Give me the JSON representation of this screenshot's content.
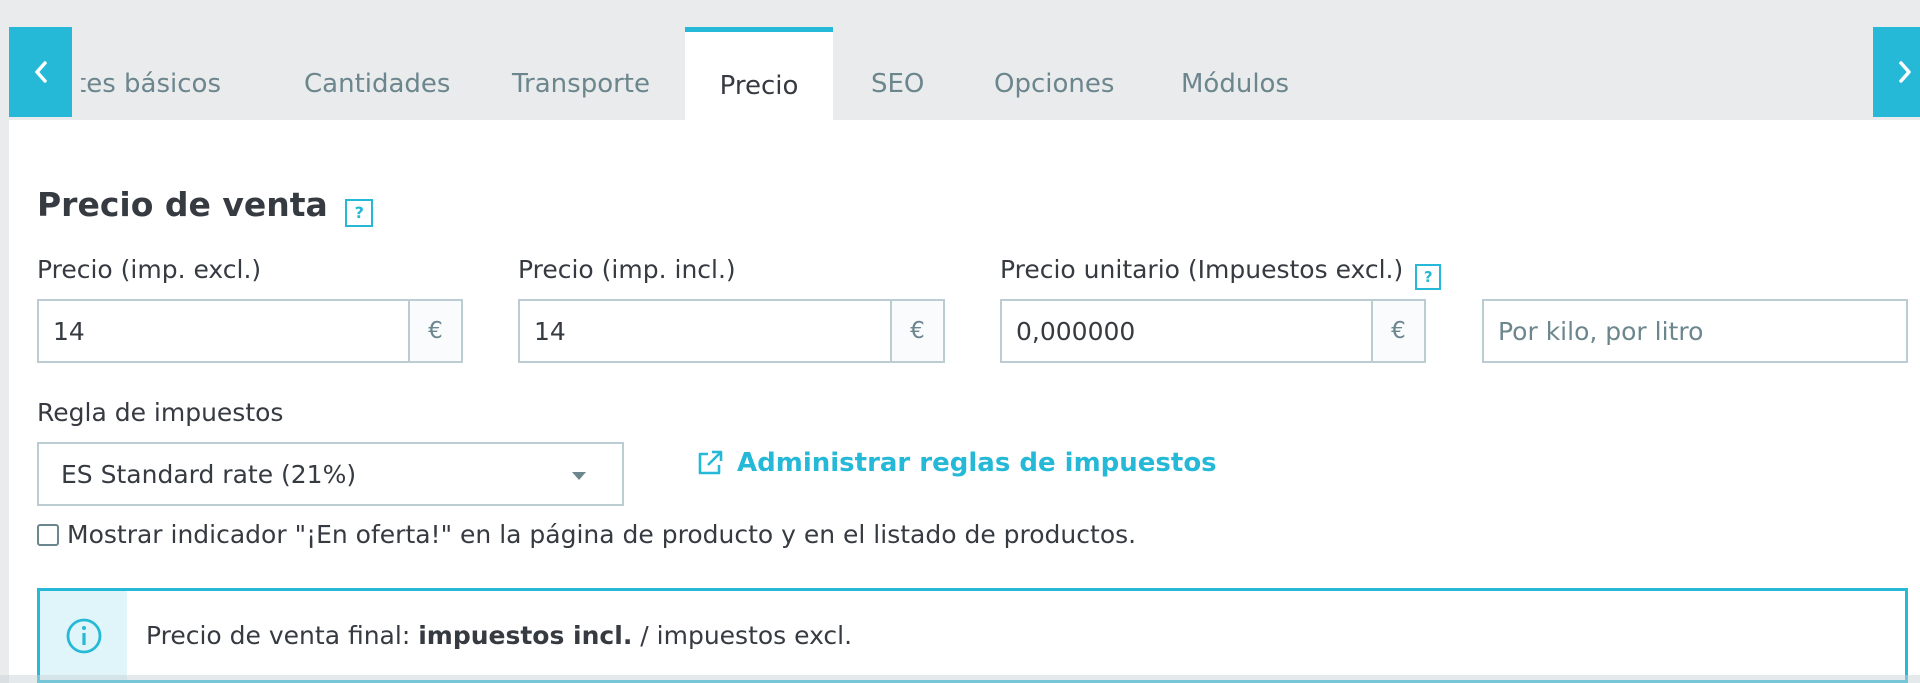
{
  "tabs": [
    {
      "label": "Ajustes básicos",
      "active": false
    },
    {
      "label": "Cantidades",
      "active": false
    },
    {
      "label": "Transporte",
      "active": false
    },
    {
      "label": "Precio",
      "active": true
    },
    {
      "label": "SEO",
      "active": false
    },
    {
      "label": "Opciones",
      "active": false
    },
    {
      "label": "Módulos",
      "active": false
    }
  ],
  "icons": {
    "prev": "chevron-left-icon",
    "next": "chevron-right-icon",
    "help": "help-icon",
    "external_link": "external-link-icon",
    "info": "info-icon",
    "caret": "caret-down-icon"
  },
  "section": {
    "title": "Precio de venta",
    "help_glyph": "?"
  },
  "fields": {
    "price_excl": {
      "label": "Precio (imp. excl.)",
      "value": "14",
      "currency": "€"
    },
    "price_incl": {
      "label": "Precio (imp. incl.)",
      "value": "14",
      "currency": "€"
    },
    "unit_price": {
      "label": "Precio unitario (Impuestos excl.)",
      "value": "0,000000",
      "currency": "€",
      "help_glyph": "?"
    },
    "unity": {
      "placeholder": "Por kilo, por litro",
      "value": ""
    }
  },
  "tax_rule": {
    "label": "Regla de impuestos",
    "selected": "ES Standard rate (21%)",
    "manage_link": "Administrar reglas de impuestos"
  },
  "on_sale": {
    "label": "Mostrar indicador \"¡En oferta!\" en la página de producto y en el listado de productos.",
    "checked": false
  },
  "alert": {
    "prefix": "Precio de venta final: ",
    "bold": "impuestos incl.",
    "suffix": " / impuestos excl."
  },
  "colors": {
    "accent": "#25b9d7",
    "text": "#363a41",
    "muted": "#6c868e",
    "border": "#bbcdd2",
    "tab_bg": "#eaebec"
  }
}
